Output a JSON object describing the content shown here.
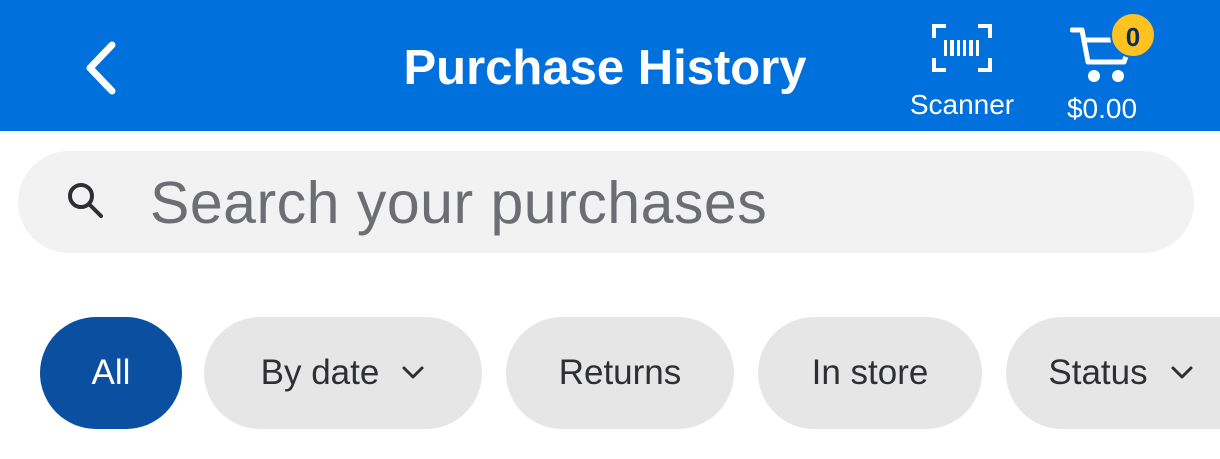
{
  "header": {
    "title": "Purchase History",
    "scanner_label": "Scanner",
    "cart_count": "0",
    "cart_total": "$0.00",
    "colors": {
      "brand": "#0071dc",
      "badge": "#ffc220"
    }
  },
  "icons": {
    "back": "back-arrow-icon",
    "scanner": "barcode-icon",
    "cart": "cart-icon",
    "search": "search-icon",
    "chevron": "chevron-down-icon"
  },
  "search": {
    "placeholder": "Search your purchases"
  },
  "filters": {
    "all": "All",
    "by_date": "By date",
    "returns": "Returns",
    "in_store": "In store",
    "status": "Status",
    "active": "All",
    "active_color": "#0b4fa0"
  }
}
